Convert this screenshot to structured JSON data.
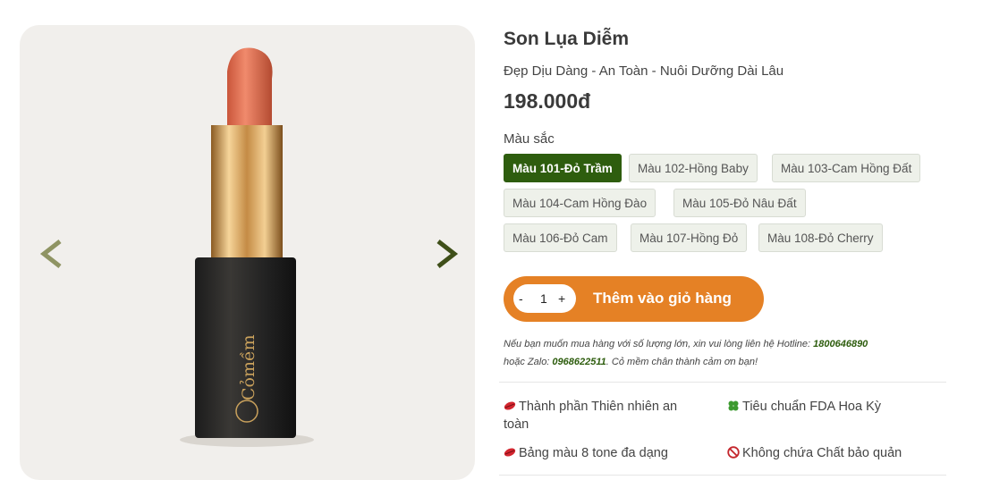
{
  "product": {
    "title": "Son Lụa Diễm",
    "subtitle": "Đẹp Dịu Dàng - An Toàn - Nuôi Dưỡng Dài Lâu",
    "price": "198.000đ",
    "brand_logo": "Cỏmềm HOME LAB"
  },
  "colors": {
    "label": "Màu sắc",
    "options": [
      "Màu 101-Đỏ Trầm",
      "Màu 102-Hồng Baby",
      "Màu 103-Cam Hồng Đất",
      "Màu 104-Cam Hồng Đào",
      "Màu 105-Đỏ Nâu Đất",
      "Màu 106-Đỏ Cam",
      "Màu 107-Hồng Đỏ",
      "Màu 108-Đỏ Cherry"
    ],
    "selected": "Màu 101-Đỏ Trầm"
  },
  "cart": {
    "minus": "-",
    "quantity": "1",
    "plus": "+",
    "add_label": "Thêm vào giỏ hàng"
  },
  "note": {
    "text1": "Nếu bạn muốn mua hàng với số lượng lớn, xin vui lòng liên hệ Hotline: ",
    "hotline": "1800646890",
    "text2": "hoặc Zalo: ",
    "zalo": "0968622511",
    "text3": ". Cỏ mềm chân thành cảm ơn bạn!"
  },
  "features": [
    {
      "icon": "lips-icon",
      "label": "Thành phần Thiên nhiên an toàn"
    },
    {
      "icon": "clover-icon",
      "label": "Tiêu chuẩn FDA Hoa Kỳ"
    },
    {
      "icon": "lips-icon",
      "label": "Bảng màu 8 tone đa dạng"
    },
    {
      "icon": "no-entry-icon",
      "label": "Không chứa Chất bảo quản"
    }
  ],
  "theme": {
    "accent_green": "#2e5d0e",
    "cart_orange": "#e58125"
  }
}
